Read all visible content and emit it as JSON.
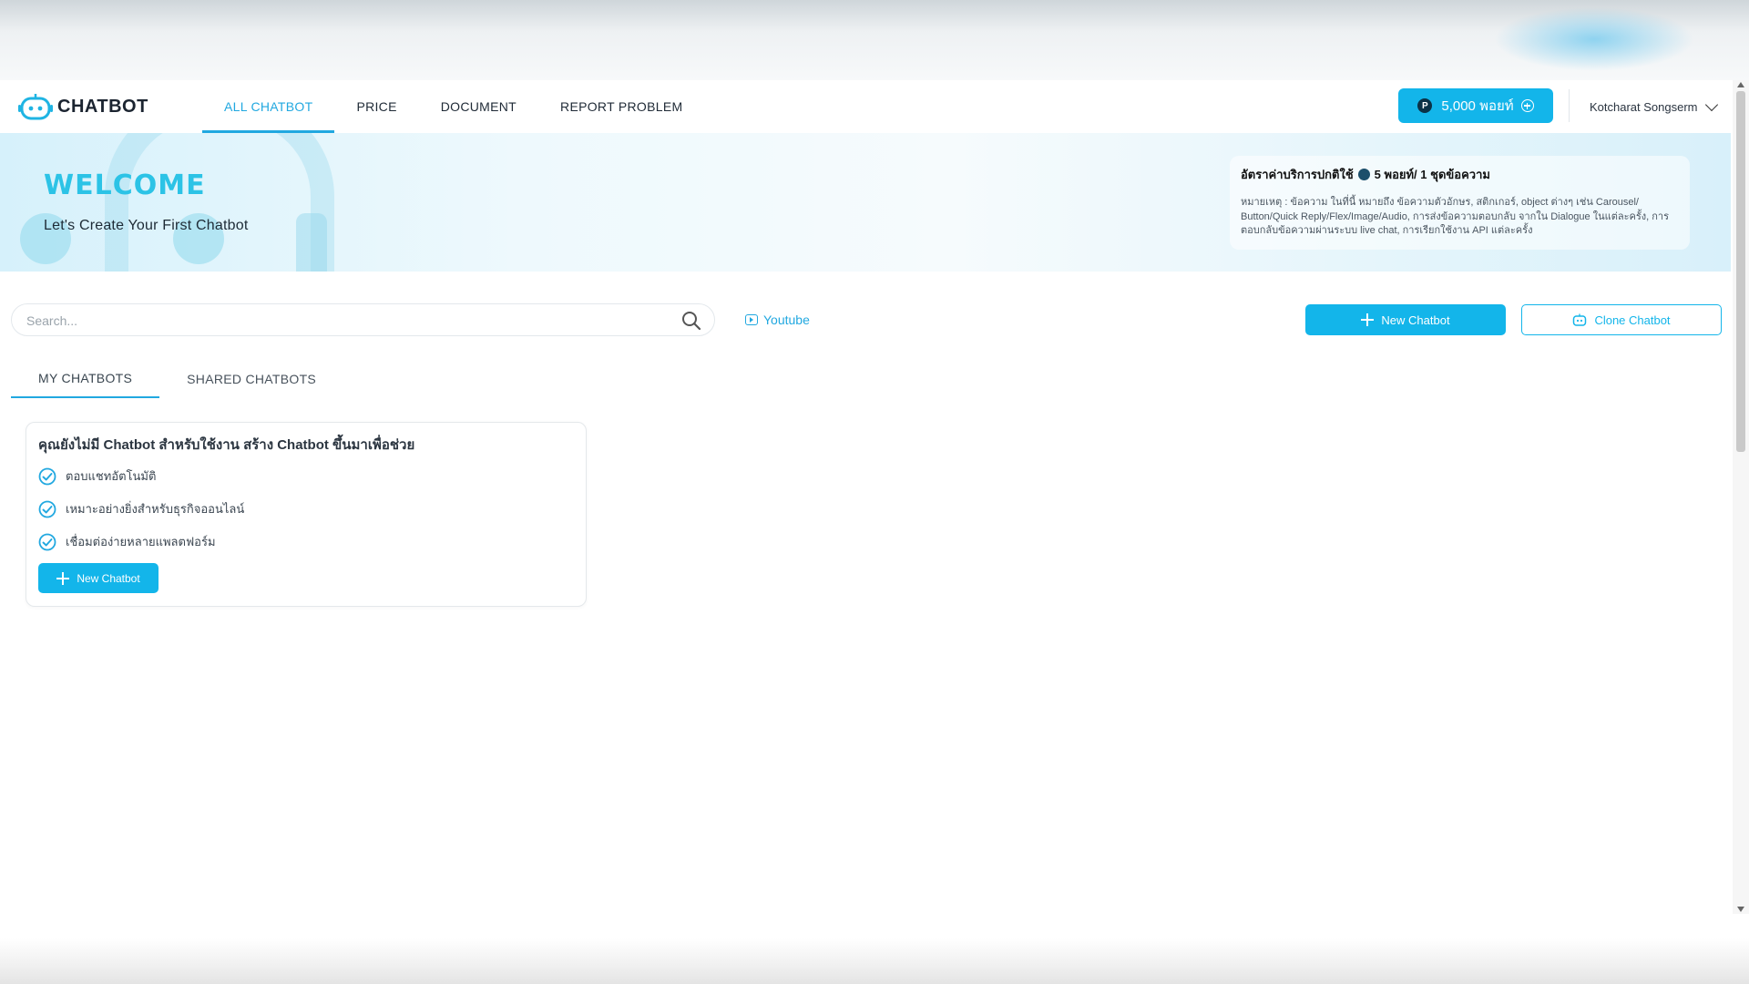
{
  "app": {
    "logo_text": "CHATBOT"
  },
  "nav": {
    "items": [
      {
        "label": "ALL CHATBOT",
        "active": true
      },
      {
        "label": "PRICE",
        "active": false
      },
      {
        "label": "DOCUMENT",
        "active": false
      },
      {
        "label": "REPORT PROBLEM",
        "active": false
      }
    ],
    "points_label": "5,000 พอยท์",
    "points_badge": "P",
    "user_name": "Kotcharat Songserm"
  },
  "banner": {
    "title": "WELCOME",
    "subtitle": "Let's Create Your First Chatbot",
    "rate_prefix": "อัตราค่าบริการปกติใช้",
    "rate_suffix": "5 พอยท์/ 1 ชุดข้อความ",
    "rate_note": "หมายเหตุ : ข้อความ ในที่นี้ หมายถึง ข้อความตัวอักษร, สติกเกอร์, object ต่างๆ เช่น Carousel/ Button/Quick Reply/Flex/Image/Audio, การส่งข้อความตอบกลับ จากใน Dialogue ในแต่ละครั้ง, การตอบกลับข้อความผ่านระบบ live chat, การเรียกใช้งาน API แต่ละครั้ง"
  },
  "toolbar": {
    "search_placeholder": "Search...",
    "youtube_label": "Youtube",
    "new_chatbot_label": "New Chatbot",
    "clone_chatbot_label": "Clone Chatbot"
  },
  "tabs": [
    {
      "label": "MY CHATBOTS",
      "active": true
    },
    {
      "label": "SHARED CHATBOTS",
      "active": false
    }
  ],
  "empty_state": {
    "title": "คุณยังไม่มี Chatbot สำหรับใช้งาน สร้าง Chatbot ขึ้นมาเพื่อช่วย",
    "features": [
      "ตอบแชทอัตโนมัติ",
      "เหมาะอย่างยิ่งสำหรับธุรกิจออนไลน์",
      "เชื่อมต่อง่ายหลายแพลตฟอร์ม"
    ],
    "button_label": "New Chatbot"
  },
  "colors": {
    "accent": "#13b5ea",
    "welcome": "#2cc3e6"
  }
}
